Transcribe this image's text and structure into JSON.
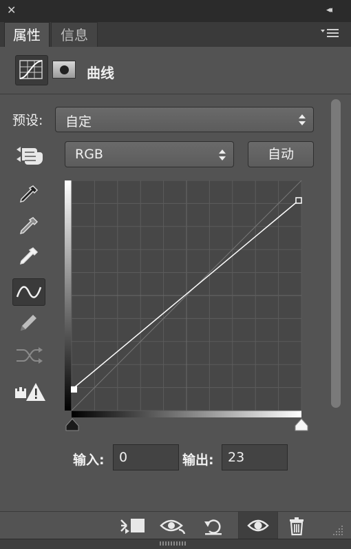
{
  "titlebar": {
    "close_glyph": "✕",
    "collapse_glyph": "◂◂"
  },
  "tabs": [
    {
      "label": "属性"
    },
    {
      "label": "信息"
    }
  ],
  "header": {
    "title": "曲线"
  },
  "preset": {
    "label": "预设:",
    "value": "自定"
  },
  "channel": {
    "value": "RGB"
  },
  "auto_button": {
    "label": "自动"
  },
  "io": {
    "input_label": "输入:",
    "input_value": "0",
    "output_label": "输出:",
    "output_value": "23"
  },
  "curve": {
    "points": [
      [
        0,
        23
      ],
      [
        255,
        255
      ]
    ],
    "range": [
      0,
      255
    ]
  },
  "colors": {
    "panel": "#535353",
    "graph_bg": "#474747",
    "curve": "#ffffff"
  }
}
